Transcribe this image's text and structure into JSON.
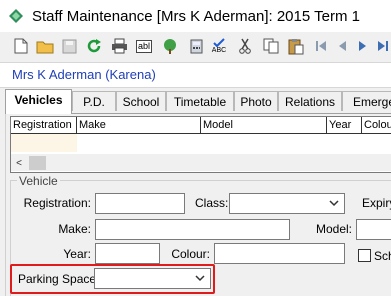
{
  "window": {
    "title": "Staff Maintenance  [Mrs K Aderman]:  2015 Term 1"
  },
  "toolbar": {
    "icons": [
      "new-document-icon",
      "open-folder-icon",
      "save-icon",
      "refresh-icon",
      "print-icon",
      "abl-icon",
      "tree-icon",
      "calculator-icon",
      "spell-check-icon",
      "cut-icon",
      "copy-icon",
      "paste-icon",
      "first-record-icon",
      "previous-record-icon",
      "next-record-icon",
      "last-record-icon"
    ],
    "abl_label": "abl",
    "abc_label": "ABC"
  },
  "record": {
    "name": "Mrs K Aderman (Karena)"
  },
  "tabs": [
    "Vehicles",
    "P.D.",
    "School",
    "Timetable",
    "Photo",
    "Relations",
    "Emerge"
  ],
  "active_tab": "Vehicles",
  "grid": {
    "columns": [
      "Registration",
      "Make",
      "Model",
      "Year",
      "Colour"
    ],
    "scroll_left": "<"
  },
  "vehicle": {
    "group_label": "Vehicle",
    "registration_label": "Registration:",
    "registration_value": "",
    "class_label": "Class:",
    "class_value": "",
    "expiry_label": "Expiry",
    "make_label": "Make:",
    "make_value": "",
    "model_label": "Model:",
    "model_value": "",
    "year_label": "Year:",
    "year_value": "",
    "colour_label": "Colour:",
    "colour_value": "",
    "checkbox_label": "Sch",
    "parking_label": "Parking Space:",
    "parking_value": ""
  },
  "colors": {
    "highlight": "#e01b1b",
    "link_blue": "#1f3fb5",
    "grid_row": "#fdf5e6"
  }
}
